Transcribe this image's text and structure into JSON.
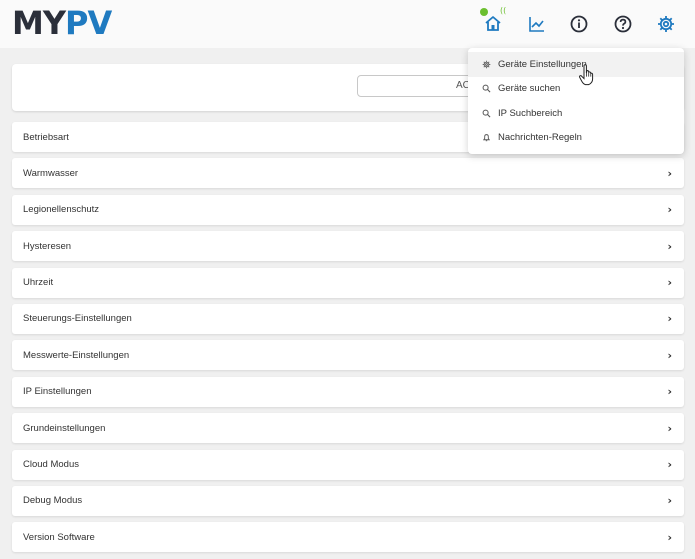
{
  "logo": {
    "part1": "MY",
    "part2": "PV"
  },
  "nav": {
    "icons": [
      "home-icon",
      "chart-icon",
      "info-icon",
      "help-icon",
      "settings-icon"
    ],
    "status_color": "#6cbf2f"
  },
  "search": {
    "placeholder": "AC"
  },
  "menu": {
    "items": [
      {
        "label": "Geräte Einstellungen",
        "icon": "gear-icon"
      },
      {
        "label": "Geräte suchen",
        "icon": "search-icon"
      },
      {
        "label": "IP Suchbereich",
        "icon": "search-icon"
      },
      {
        "label": "Nachrichten-Regeln",
        "icon": "bell-icon"
      }
    ]
  },
  "settings": {
    "items": [
      {
        "label": "Betriebsart"
      },
      {
        "label": "Warmwasser"
      },
      {
        "label": "Legionellenschutz"
      },
      {
        "label": "Hysteresen"
      },
      {
        "label": "Uhrzeit"
      },
      {
        "label": "Steuerungs-Einstellungen"
      },
      {
        "label": "Messwerte-Einstellungen"
      },
      {
        "label": "IP Einstellungen"
      },
      {
        "label": "Grundeinstellungen"
      },
      {
        "label": "Cloud Modus"
      },
      {
        "label": "Debug Modus"
      },
      {
        "label": "Version Software"
      }
    ],
    "chevron": "›"
  }
}
